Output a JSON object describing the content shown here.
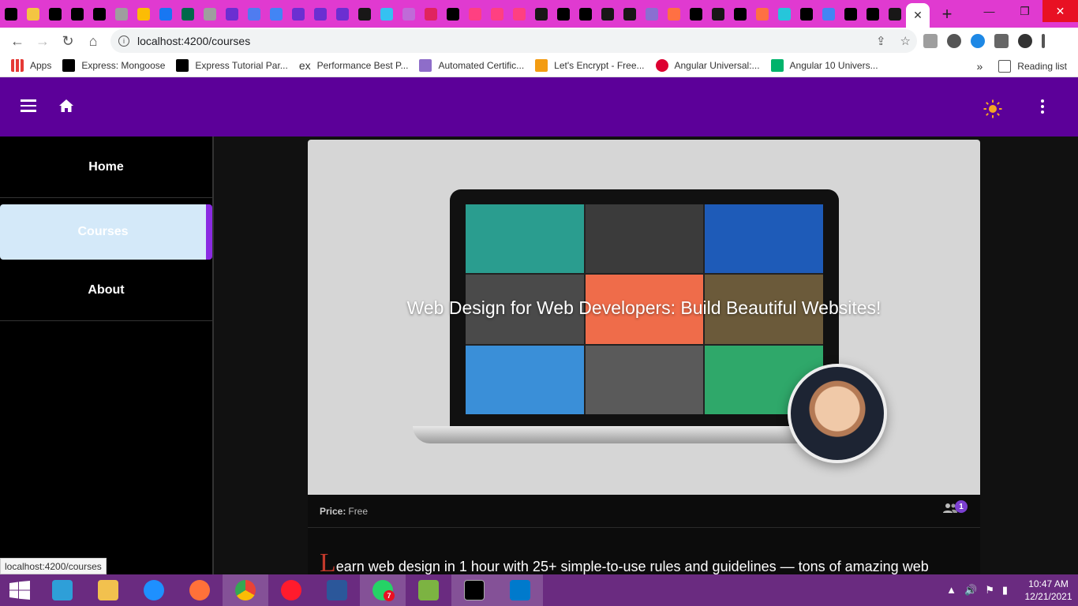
{
  "browser": {
    "url": "localhost:4200/courses",
    "status_url": "localhost:4200/courses",
    "tab_close_glyph": "✕",
    "new_tab_glyph": "+",
    "favicon_colors": [
      "#000000",
      "#f4c542",
      "#000000",
      "#000000",
      "#000000",
      "#9e9e9e",
      "#fbbc05",
      "#1877f2",
      "#00684a",
      "#9e9e9e",
      "#6b2fd1",
      "#4f7cf0",
      "#4285f4",
      "#6b2fd1",
      "#6b2fd1",
      "#6b2fd1",
      "#181717",
      "#35c1f1",
      "#c06ad8",
      "#e0245e",
      "#000000",
      "#ff4081",
      "#ff4081",
      "#ff4081",
      "#181717",
      "#000000",
      "#000000",
      "#181717",
      "#181717",
      "#8a6fd1",
      "#ff7043",
      "#000000",
      "#181717",
      "#000000",
      "#ff7043",
      "#26c6da",
      "#000000",
      "#4285f4",
      "#000000",
      "#000000",
      "#181717"
    ]
  },
  "bookmarks": {
    "items": [
      {
        "label": "Apps",
        "color": "#e53935"
      },
      {
        "label": "Express: Mongoose",
        "color": "#000000"
      },
      {
        "label": "Express Tutorial Par...",
        "color": "#000000"
      },
      {
        "label": "Performance Best P...",
        "color": "#ffffff"
      },
      {
        "label": "Automated Certific...",
        "color": "#8e6dc9"
      },
      {
        "label": "Let's Encrypt - Free...",
        "color": "#f39c12"
      },
      {
        "label": "Angular Universal:...",
        "color": "#dd0031"
      },
      {
        "label": "Angular 10 Univers...",
        "color": "#00b36b"
      }
    ],
    "ex_prefix": "ex",
    "more": "»",
    "reading_list": "Reading list"
  },
  "sidebar": {
    "items": [
      {
        "label": "Home"
      },
      {
        "label": "Courses"
      },
      {
        "label": "About"
      }
    ]
  },
  "course": {
    "title": "Web Design for Web Developers: Build Beautiful Websites!",
    "price_label": "Price:",
    "price_value": "Free",
    "students_badge": "1",
    "desc_dropcap": "L",
    "desc_rest": "earn web design in 1 hour with 25+ simple-to-use rules and guidelines — tons of amazing web"
  },
  "colors": {
    "header": "#5c0099",
    "accent": "#8a2be2",
    "active_nav_bg": "#d4e9f9",
    "sun": "#f5a623"
  },
  "taskbar": {
    "time": "10:47 AM",
    "date": "12/21/2021",
    "whatsapp_badge": "7",
    "apps": [
      {
        "name": "calculator",
        "color": "#2e9fd8"
      },
      {
        "name": "file-explorer",
        "color": "#f2c14e"
      },
      {
        "name": "internet-explorer",
        "color": "#1e90ff"
      },
      {
        "name": "firefox",
        "color": "#ff7139"
      },
      {
        "name": "chrome",
        "color": "#4caf50"
      },
      {
        "name": "opera",
        "color": "#ff1b2d"
      },
      {
        "name": "word",
        "color": "#2b579a"
      },
      {
        "name": "whatsapp",
        "color": "#25d366"
      },
      {
        "name": "app-green",
        "color": "#7cb342"
      },
      {
        "name": "terminal",
        "color": "#000000"
      },
      {
        "name": "vscode",
        "color": "#007acc"
      }
    ]
  }
}
